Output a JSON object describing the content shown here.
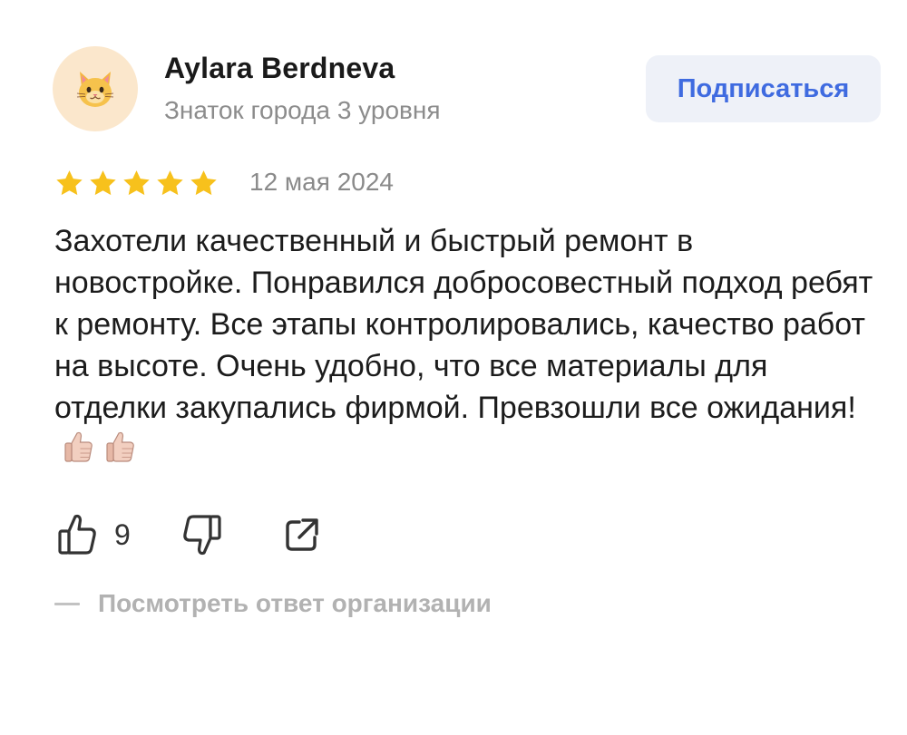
{
  "author": {
    "name": "Aylara Berdneva",
    "level": "Знаток города 3 уровня",
    "avatar_icon": "cat-face-icon"
  },
  "subscribe_label": "Подписаться",
  "rating": {
    "value": 5,
    "max": 5,
    "color": "#f7c11c"
  },
  "date": "12 мая 2024",
  "review_text": "Захотели качественный и быстрый ремонт в новостройке. Понравился добросовестный подход ребят к ремонту. Все этапы контролировались, качество работ на высоте. Очень удобно, что все материалы для отделки закупались фирмой. Превзошли все ожидания!",
  "emojis": [
    "thumbs-up-emoji",
    "thumbs-up-emoji"
  ],
  "actions": {
    "like_count": "9",
    "like_icon": "thumbs-up-icon",
    "dislike_icon": "thumbs-down-icon",
    "share_icon": "share-icon"
  },
  "org_answer_label": "Посмотреть ответ организации",
  "colors": {
    "accent": "#3f6be0",
    "button_bg": "#eef1f8",
    "muted_text": "#8c8c8c",
    "avatar_bg": "#fbe7cc"
  }
}
